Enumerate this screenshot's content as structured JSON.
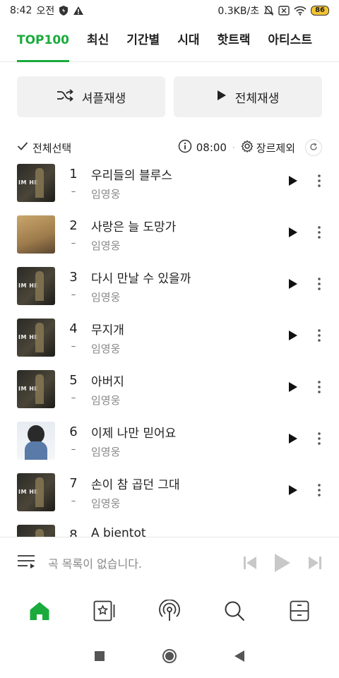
{
  "status": {
    "time": "8:42",
    "ampm": "오전",
    "speed": "0.3KB/초",
    "battery": "86"
  },
  "tabs": [
    {
      "label": "TOP100"
    },
    {
      "label": "최신"
    },
    {
      "label": "기간별"
    },
    {
      "label": "시대"
    },
    {
      "label": "핫트랙"
    },
    {
      "label": "아티스트"
    }
  ],
  "actions": {
    "shuffle": "셔플재생",
    "play_all": "전체재생"
  },
  "toolbar": {
    "select_all": "전체선택",
    "update_time": "08:00",
    "genre_exclude": "장르제외"
  },
  "songs": [
    {
      "rank": "1",
      "change": "–",
      "title": "우리들의 블루스",
      "artist": "임영웅"
    },
    {
      "rank": "2",
      "change": "–",
      "title": "사랑은 늘 도망가",
      "artist": "임영웅"
    },
    {
      "rank": "3",
      "change": "–",
      "title": "다시 만날 수 있을까",
      "artist": "임영웅"
    },
    {
      "rank": "4",
      "change": "–",
      "title": "무지개",
      "artist": "임영웅"
    },
    {
      "rank": "5",
      "change": "–",
      "title": "아버지",
      "artist": "임영웅"
    },
    {
      "rank": "6",
      "change": "–",
      "title": "이제 나만 믿어요",
      "artist": "임영웅"
    },
    {
      "rank": "7",
      "change": "–",
      "title": "손이 참 곱던 그대",
      "artist": "임영웅"
    },
    {
      "rank": "8",
      "change": "",
      "title": "A bientot",
      "artist": ""
    }
  ],
  "player": {
    "empty_message": "곡 목록이 없습니다."
  },
  "colors": {
    "accent": "#1aab3c"
  }
}
